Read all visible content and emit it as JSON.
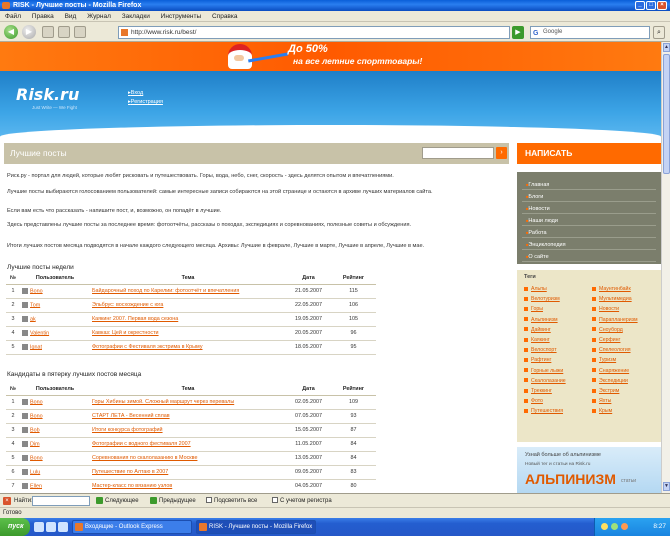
{
  "window": {
    "title": "RISK - Лучшие посты - Mozilla Firefox",
    "menu": [
      "Файл",
      "Правка",
      "Вид",
      "Журнал",
      "Закладки",
      "Инструменты",
      "Справка"
    ]
  },
  "nav": {
    "url": "http://www.risk.ru/best/",
    "search_placeholder": "Google",
    "search_engine_icon": "G"
  },
  "banner": {
    "line1": "До 50%",
    "line2": "на все летние спорттовары!"
  },
  "header": {
    "logo": "Risk.ru",
    "tagline": "Just Write — We Fight",
    "links": [
      "Вход",
      "Регистрация"
    ]
  },
  "page": {
    "title": "Лучшие посты",
    "search_value": "",
    "write_button": "НАПИСАТЬ",
    "intro": [
      "Риск.ру - портал для людей, которые любят рисковать и путешествовать. Горы, вода, небо, снег, скорость - здесь делятся опытом и впечатлениями.",
      "Лучшие посты выбираются голосованием пользователей: самые интересные записи собираются на этой странице и остаются в архиве лучших материалов сайта.",
      "Если вам есть что рассказать - напишите пост, и, возможно, он попадёт в лучшие.",
      "Здесь представлены лучшие посты за последнее время: фотоотчёты, рассказы о походах, экспедициях и соревнованиях, полезные советы и обсуждения.",
      "Итоги лучших постов месяца подводятся в начале каждого следующего месяца. Архивы: Лучшие в феврале, Лучшие в марте, Лучшие в апреле, Лучшие в мае."
    ],
    "section1_title": "Лучшие посты недели",
    "section2_title": "Кандидаты в пятерку лучших постов месяца",
    "columns": [
      "№",
      "Пользователь",
      "Тема",
      "Дата",
      "Рейтинг"
    ],
    "table1": [
      {
        "n": "1",
        "user": "Bono",
        "topic": "Байдарочный поход по Карелии: фотоотчёт и впечатления",
        "date": "21.05.2007",
        "rating": "115"
      },
      {
        "n": "2",
        "user": "Tom",
        "topic": "Эльбрус: восхождение с юга",
        "date": "22.05.2007",
        "rating": "106"
      },
      {
        "n": "3",
        "user": "ak",
        "topic": "Каякинг 2007. Первая вода сезона",
        "date": "19.05.2007",
        "rating": "105"
      },
      {
        "n": "4",
        "user": "Valentin",
        "topic": "Кавказ: Цей и окрестности",
        "date": "20.05.2007",
        "rating": "96"
      },
      {
        "n": "5",
        "user": "Ignat",
        "topic": "Фотографии с Фестиваля экстрима в Крыму",
        "date": "18.05.2007",
        "rating": "95"
      }
    ],
    "table2": [
      {
        "n": "1",
        "user": "Bono",
        "topic": "Горы Хибины зимой. Сложный маршрут через перевалы",
        "date": "02.05.2007",
        "rating": "109"
      },
      {
        "n": "2",
        "user": "Bono",
        "topic": "СТАРТ ЛЕТА - Весенний сплав",
        "date": "07.05.2007",
        "rating": "93"
      },
      {
        "n": "3",
        "user": "Bob",
        "topic": "Итоги конкурса фотографий",
        "date": "15.05.2007",
        "rating": "87"
      },
      {
        "n": "4",
        "user": "Dim",
        "topic": "Фотографии с водного фестиваля 2007",
        "date": "11.05.2007",
        "rating": "84"
      },
      {
        "n": "5",
        "user": "Bono",
        "topic": "Соревнования по скалолазанию в Москве",
        "date": "13.05.2007",
        "rating": "84"
      },
      {
        "n": "6",
        "user": "Lulu",
        "topic": "Путешествие по Алтаю в 2007",
        "date": "09.05.2007",
        "rating": "83"
      },
      {
        "n": "7",
        "user": "Ellen",
        "topic": "Мастер-класс по вязанию узлов",
        "date": "04.05.2007",
        "rating": "80"
      }
    ]
  },
  "sidebar": {
    "nav": [
      "Главная",
      "Блоги",
      "Новости",
      "Наши люди",
      "Работа",
      "Энциклопедия",
      "О сайте"
    ],
    "tags_title": "Теги",
    "tags_left": [
      "Альпы",
      "Велотуризм",
      "Горы",
      "Альпинизм",
      "Дайвинг",
      "Каякинг",
      "Велоспорт",
      "Рафтинг",
      "Горные лыжи",
      "Скалолазание",
      "Треккинг",
      "Фото",
      "Путешествия"
    ],
    "tags_right": [
      "Маунтинбайк",
      "Мультимедиа",
      "Новости",
      "Парапланеризм",
      "Сноуборд",
      "Серфинг",
      "Спелеология",
      "Туризм",
      "Снаряжение",
      "Экспедиции",
      "Экстрим",
      "Яхты",
      "Крым"
    ],
    "promo_title": "Узнай больше об альпинизме",
    "promo_sub": "Новый тег и статьи на Risk.ru",
    "promo_big": "АЛЬПИНИЗМ",
    "promo_small": "статьи"
  },
  "find": {
    "label": "Найти:",
    "value": "",
    "next": "Следующее",
    "prev": "Предыдущее",
    "highlight": "Подсветить все",
    "matchcase": "С учетом регистра"
  },
  "status": {
    "text": "Готово"
  },
  "taskbar": {
    "start": "пуск",
    "tasks": [
      "Входящие - Outlook Express",
      "RISK - Лучшие посты - Mozilla Firefox"
    ],
    "clock": "8:27"
  },
  "colors": {
    "accent": "#ff6a00",
    "header_blue": "#1f7fc8",
    "sidebar_grey": "#7b7e6c",
    "tag_bg": "#ece6c8"
  }
}
